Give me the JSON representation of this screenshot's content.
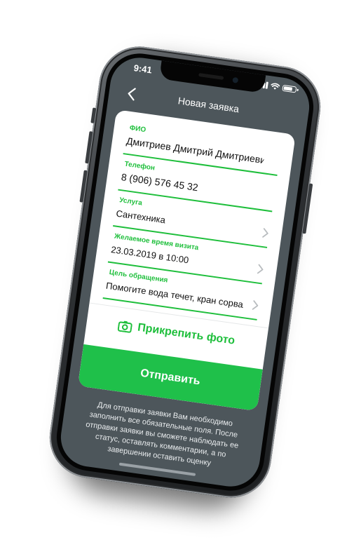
{
  "status_bar": {
    "time": "9:41"
  },
  "nav": {
    "title": "Новая заявка"
  },
  "form": {
    "fields": [
      {
        "label": "ФИО",
        "value": "Дмитриев Дмитрий Дмитриевич",
        "has_chevron": false
      },
      {
        "label": "Телефон",
        "value": "8 (906) 576 45 32",
        "has_chevron": false
      },
      {
        "label": "Услуга",
        "value": "Сантехника",
        "has_chevron": true
      },
      {
        "label": "Желаемое время визита",
        "value": "23.03.2019 в 10:00",
        "has_chevron": true
      },
      {
        "label": "Цель обращения",
        "value": "Помогите вода течет, кран сорвало...",
        "has_chevron": true
      }
    ],
    "attach_label": "Прикрепить фото",
    "submit_label": "Отправить"
  },
  "hint_text": "Для отправки заявки Вам необходимо заполнить все обязательные поля. После отправки заявки вы сможете наблюдать ее статус, оставлять комментарии, а по завершении оставить оценку",
  "colors": {
    "accent": "#1fbf3c",
    "screen_bg": "#4d565b",
    "card_bg": "#ffffff"
  },
  "icons": {
    "back": "chevron-left-icon",
    "attach": "camera-icon",
    "field_action": "chevron-right-icon",
    "status": [
      "signal-icon",
      "wifi-icon",
      "battery-icon"
    ]
  }
}
